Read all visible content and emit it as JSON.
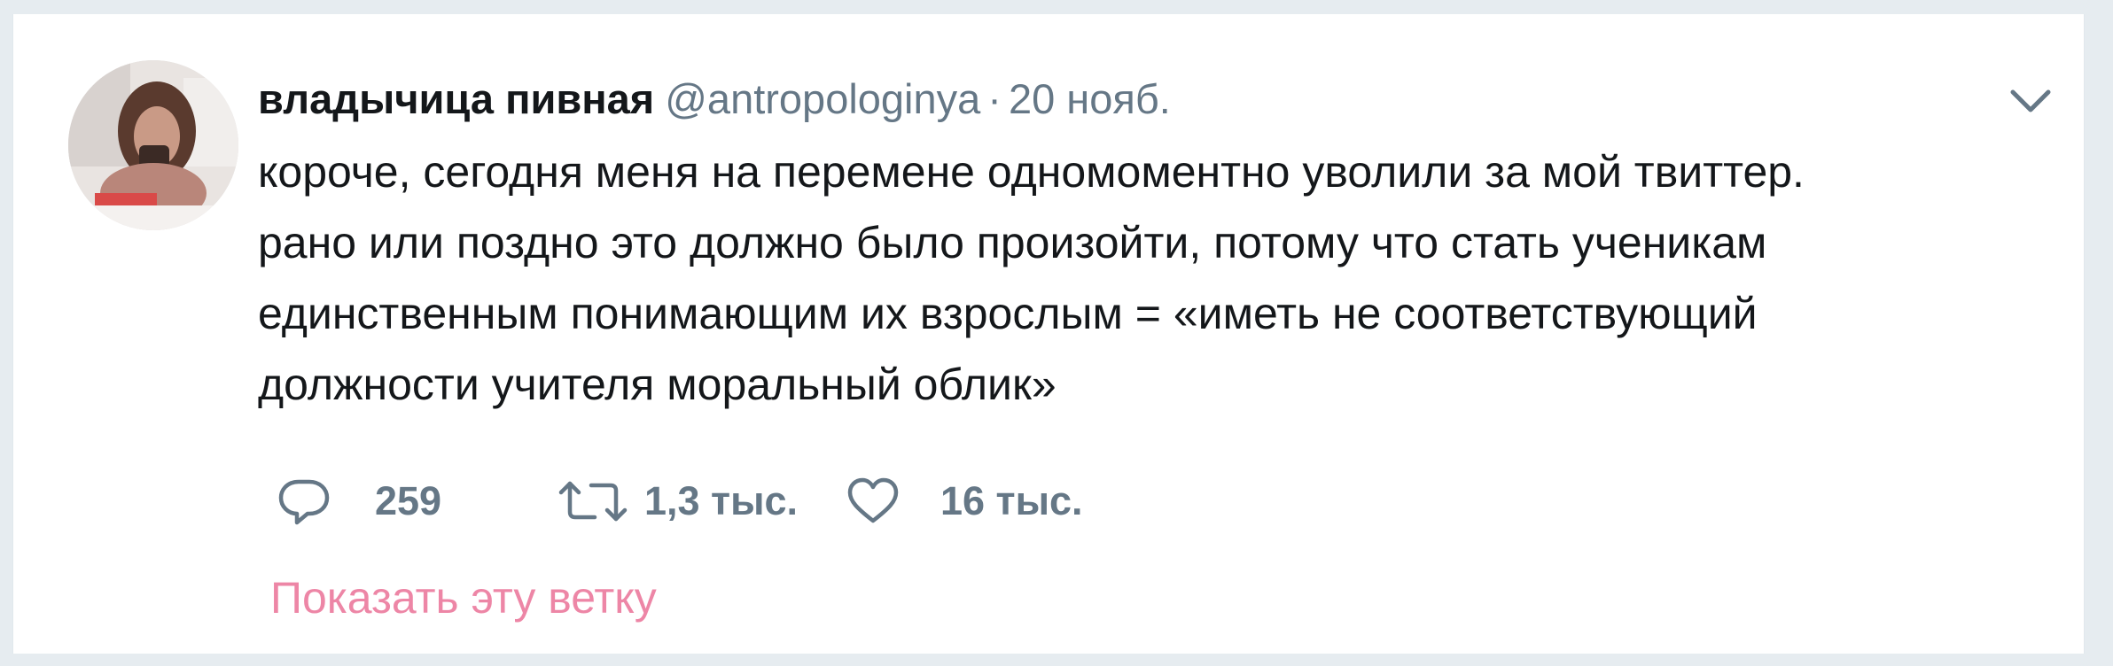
{
  "tweet": {
    "author": {
      "display_name": "владычица пивная",
      "handle": "@antropologinya",
      "avatar_icon": "user-photo-avatar"
    },
    "separator": "·",
    "date": "20 нояб.",
    "text_lines": [
      "короче, сегодня меня на перемене одномоментно уволили за мой твиттер.",
      "рано или поздно это должно было произойти, потому что стать ученикам",
      "единственным понимающим их взрослым = «иметь не соответствующий",
      "должности учителя моральный облик»"
    ],
    "actions": {
      "reply": {
        "count": "259",
        "icon": "reply-icon"
      },
      "retweet": {
        "count": "1,3 тыс.",
        "icon": "retweet-icon"
      },
      "like": {
        "count": "16 тыс.",
        "icon": "heart-icon"
      }
    },
    "show_thread": "Показать эту ветку",
    "menu_icon": "chevron-down-icon"
  },
  "colors": {
    "text_primary": "#14171a",
    "text_secondary": "#657786",
    "thread_link": "#e0245e",
    "background": "#e6ecf0"
  }
}
